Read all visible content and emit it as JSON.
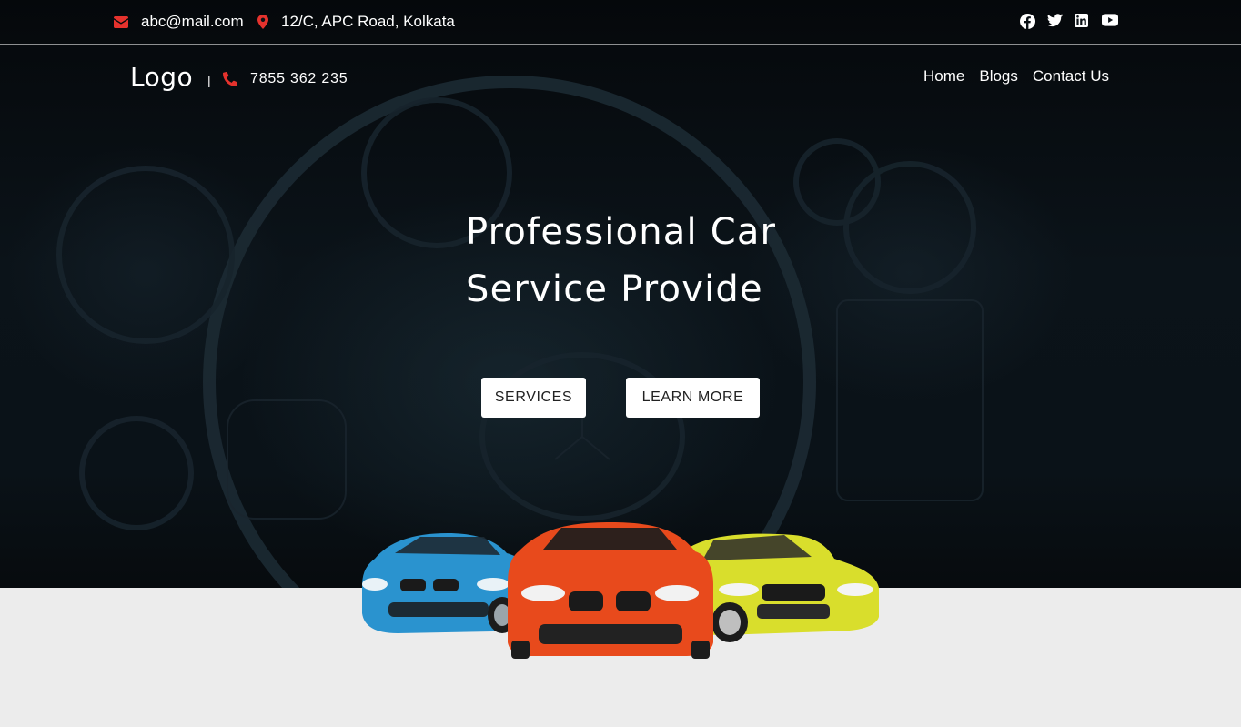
{
  "topbar": {
    "email": "abc@mail.com",
    "address": "12/C, APC Road, Kolkata",
    "social_icons": [
      "facebook-icon",
      "twitter-icon",
      "linkedin-icon",
      "youtube-icon"
    ]
  },
  "navbar": {
    "logo": "Logo",
    "separator": "|",
    "phone": "7855 362 235",
    "links": [
      "Home",
      "Blogs",
      "Contact Us"
    ]
  },
  "hero": {
    "title_line1": "Professional Car",
    "title_line2": "Service Provide",
    "buttons": {
      "services": "SERVICES",
      "learn_more": "LEARN MORE"
    },
    "image": "three-sports-cars-image"
  },
  "colors": {
    "accent": "#e5322d",
    "hero_background": "#0a1218",
    "page_background": "#ececec",
    "button_background": "#ffffff",
    "car_blue": "#2a93cf",
    "car_orange": "#e84a1c",
    "car_yellow": "#d9de2c"
  }
}
